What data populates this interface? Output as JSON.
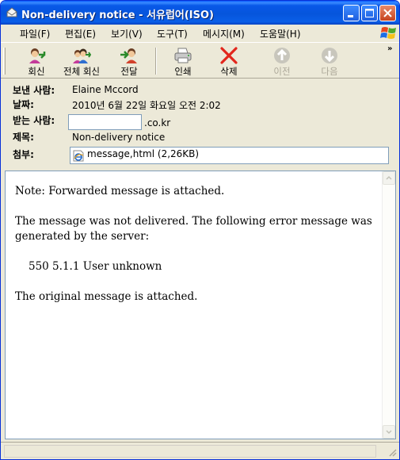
{
  "window": {
    "title": "Non-delivery notice - 서유럽어(ISO)"
  },
  "menu": [
    {
      "label": "파일(F)"
    },
    {
      "label": "편집(E)"
    },
    {
      "label": "보기(V)"
    },
    {
      "label": "도구(T)"
    },
    {
      "label": "메시지(M)"
    },
    {
      "label": "도움말(H)"
    }
  ],
  "toolbar": {
    "reply_label": "회신",
    "reply_all_label": "전체 회신",
    "forward_label": "전달",
    "print_label": "인쇄",
    "delete_label": "삭제",
    "previous_label": "이전",
    "next_label": "다음",
    "overflow_glyph": "»"
  },
  "header": {
    "from_label": "보낸 사람:",
    "from_value": "Elaine Mccord",
    "date_label": "날짜:",
    "date_value": "2010년 6월 22일 화요일 오전 2:02",
    "to_label": "받는 사람:",
    "to_suffix": ".co.kr",
    "subject_label": "제목:",
    "subject_value": "Non-delivery notice",
    "attach_label": "첨부:",
    "attachment": "message,html (2,26KB)"
  },
  "message": {
    "line1": "Note: Forwarded message is attached.",
    "line2": "The message was not delivered.  The following error message was generated by the server:",
    "line3": "550 5.1.1 User unknown",
    "line4": "The original message is attached."
  },
  "colors": {
    "titlebar": "#0855dd",
    "window_face": "#ece9d8",
    "close_button": "#c6431e"
  }
}
